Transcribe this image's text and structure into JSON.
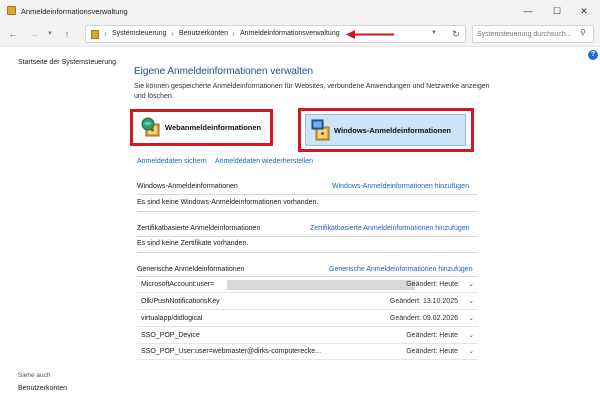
{
  "window": {
    "title": "Anmeldeinformationsverwaltung"
  },
  "nav": {
    "breadcrumbs": [
      "Systemsteuerung",
      "Benutzerkonten",
      "Anmeldeinformationsverwaltung"
    ],
    "search_placeholder": "Systemsteuerung durchsuch..."
  },
  "sidebar": {
    "home_link": "Startseite der Systemsteuerung",
    "see_also": "Siehe auch",
    "accounts_link": "Benutzerkonten"
  },
  "main": {
    "title": "Eigene Anmeldeinformationen verwalten",
    "description": "Sie können gespeicherte Anmeldeinformationen für Websites, verbundene Anwendungen und Netzwerke anzeigen und löschen.",
    "categories": {
      "web": "Webanmeldeinformationen",
      "windows": "Windows-Anmeldeinformationen"
    },
    "backup_link": "Anmeldedaten sichern",
    "restore_link": "Anmeldedaten wiederherstellen",
    "windows_section": {
      "title": "Windows-Anmeldeinformationen",
      "add_link": "Windows-Anmeldeinformationen hinzufügen",
      "empty": "Es sind keine Windows-Anmeldeinformationen vorhanden."
    },
    "cert_section": {
      "title": "Zertifikatbasierte Anmeldeinformationen",
      "add_link": "Zertifikatbasierte Anmeldeinformationen hinzufügen",
      "empty": "Es sind keine Zertifikate vorhanden."
    },
    "generic_section": {
      "title": "Generische Anmeldeinformationen",
      "add_link": "Generische Anmeldeinformationen hinzufügen",
      "items": [
        {
          "name": "MicrosoftAccount:user=",
          "changed": "Geändert:  Heute"
        },
        {
          "name": "Olk/PushNotificationsKey",
          "changed": "Geändert:  13.10.2025"
        },
        {
          "name": "virtualapp/didlogical",
          "changed": "Geändert:  09.02.2026"
        },
        {
          "name": "SSO_POP_Device",
          "changed": "Geändert:  Heute"
        },
        {
          "name": "SSO_POP_User:user=webmaster@dirks-computerecke...",
          "changed": "Geändert:  Heute"
        }
      ]
    }
  },
  "colors": {
    "highlight": "#d3161f",
    "link": "#1a66c2",
    "title": "#1e4e8c",
    "selected_category": "#cbe4f7"
  }
}
